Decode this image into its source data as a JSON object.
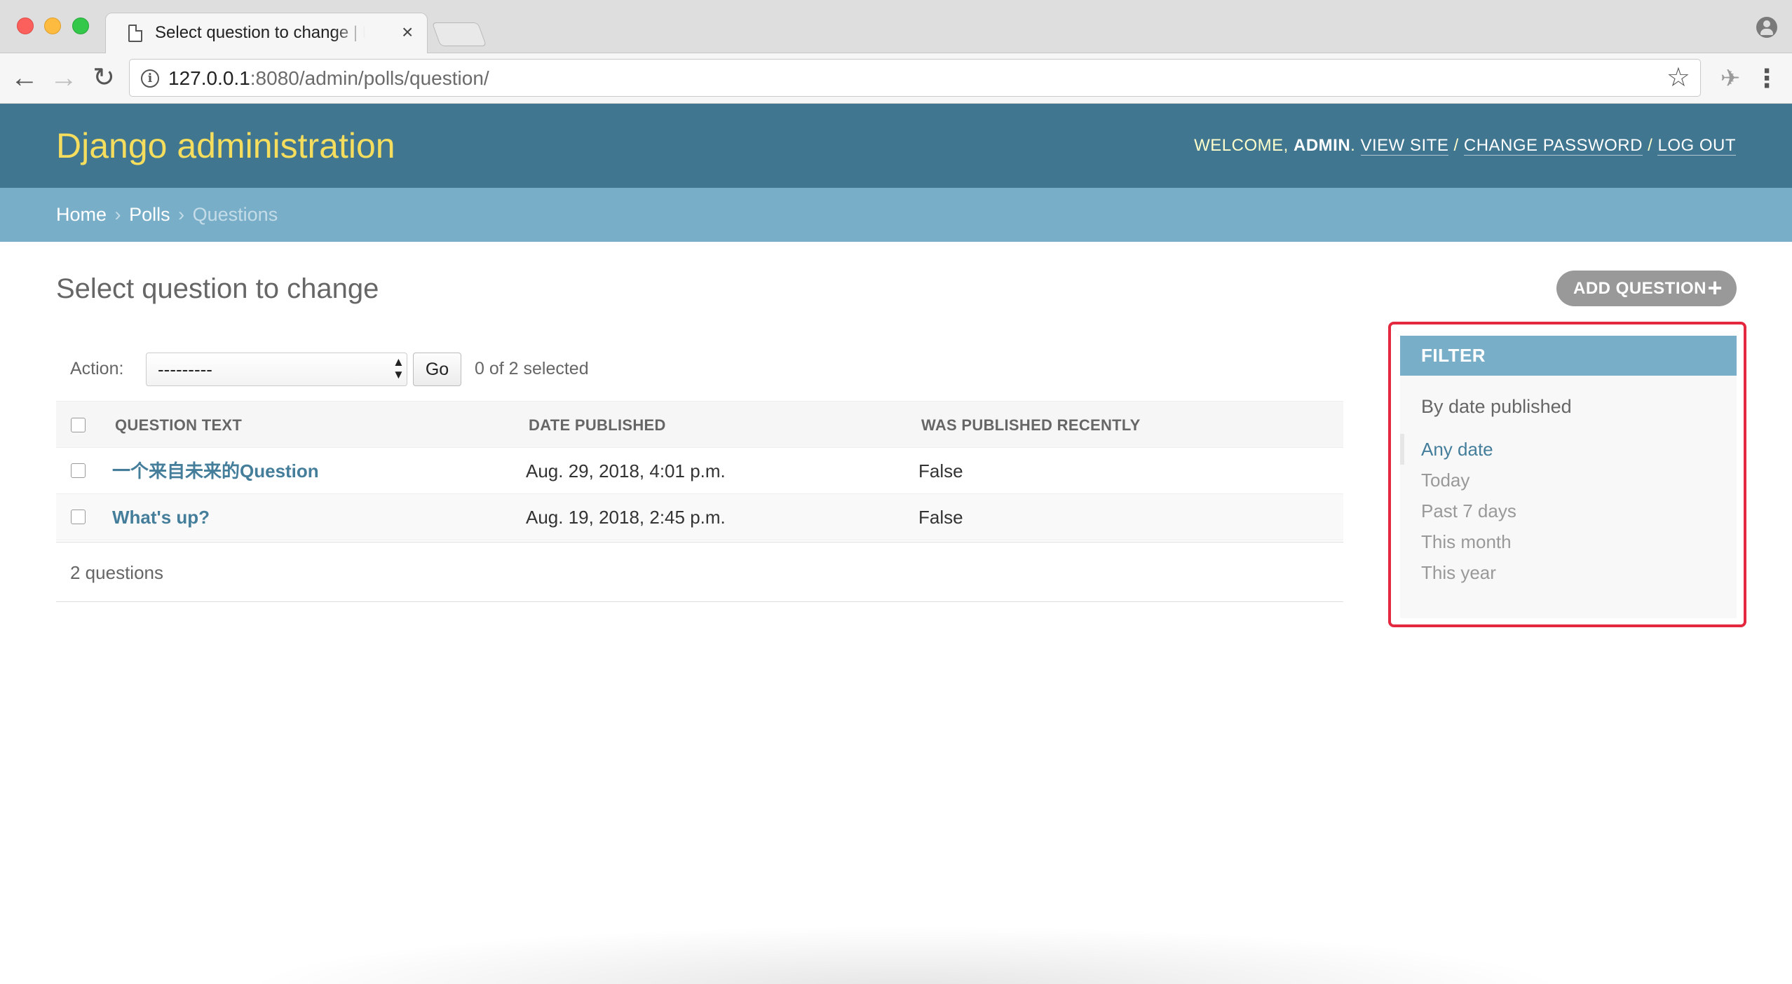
{
  "browser": {
    "tab_title": "Select question to change | Django site admin",
    "tab_close": "×",
    "url_host": "127.0.0.1",
    "url_rest": ":8080/admin/polls/question/"
  },
  "header": {
    "branding": "Django administration",
    "welcome": "WELCOME,",
    "username": "ADMIN",
    "view_site": "VIEW SITE",
    "change_password": "CHANGE PASSWORD",
    "log_out": "LOG OUT"
  },
  "breadcrumbs": {
    "home": "Home",
    "app": "Polls",
    "current": "Questions"
  },
  "page": {
    "title": "Select question to change",
    "add_button": "ADD QUESTION"
  },
  "actions": {
    "label": "Action:",
    "selected_option": "---------",
    "go": "Go",
    "counter": "0 of 2 selected"
  },
  "table": {
    "columns": [
      "QUESTION TEXT",
      "DATE PUBLISHED",
      "WAS PUBLISHED RECENTLY"
    ],
    "rows": [
      {
        "question_text": "一个来自未来的Question",
        "date_published": "Aug. 29, 2018, 4:01 p.m.",
        "was_published_recently": "False"
      },
      {
        "question_text": "What's up?",
        "date_published": "Aug. 19, 2018, 2:45 p.m.",
        "was_published_recently": "False"
      }
    ],
    "paginator": "2 questions"
  },
  "filter": {
    "title": "FILTER",
    "subtitle": "By date published",
    "options": [
      "Any date",
      "Today",
      "Past 7 days",
      "This month",
      "This year"
    ],
    "selected": "Any date"
  },
  "colors": {
    "header_bg": "#417690",
    "breadcrumbs_bg": "#79aec8",
    "branding": "#f5dd5d",
    "link": "#447e9b",
    "highlight": "#e3283f"
  }
}
